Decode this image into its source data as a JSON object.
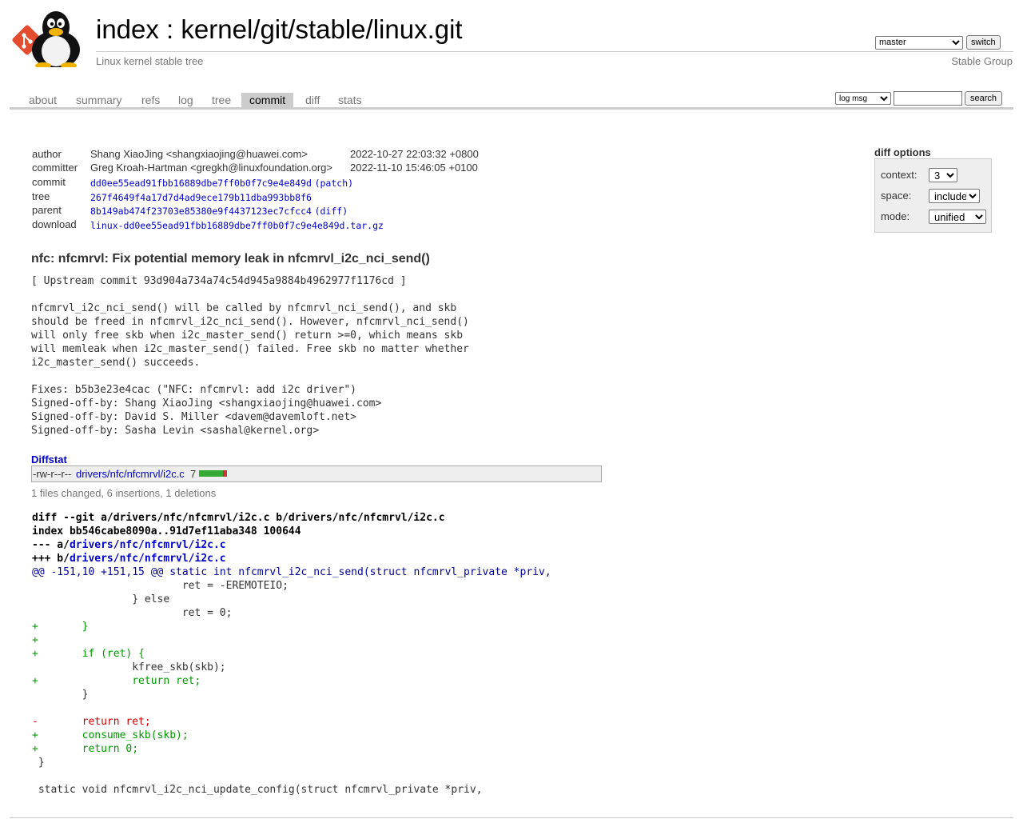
{
  "header": {
    "index_link": "index",
    "separator": " : ",
    "repo_path": "kernel/git/stable/linux.git",
    "description": "Linux kernel stable tree",
    "owner": "Stable Group",
    "branch_selected": "master",
    "switch_label": "switch"
  },
  "tabs": [
    "about",
    "summary",
    "refs",
    "log",
    "tree",
    "commit",
    "diff",
    "stats"
  ],
  "active_tab": "commit",
  "search": {
    "mode_selected": "log msg",
    "button_label": "search"
  },
  "diff_options": {
    "title": "diff options",
    "context_label": "context:",
    "context_value": "3",
    "space_label": "space:",
    "space_value": "include",
    "mode_label": "mode:",
    "mode_value": "unified"
  },
  "commit": {
    "author_label": "author",
    "author": "Shang XiaoJing <shangxiaojing@huawei.com>",
    "author_date": "2022-10-27 22:03:32 +0800",
    "committer_label": "committer",
    "committer": "Greg Kroah-Hartman <gregkh@linuxfoundation.org>",
    "committer_date": "2022-11-10 15:46:05 +0100",
    "commit_label": "commit",
    "commit_hash": "dd0ee55ead91fbb16889dbe7ff0b0f7c9e4e849d",
    "patch_link": "(patch)",
    "tree_label": "tree",
    "tree_hash": "267f4649f4a17d7d4ad9ece179b11dba993bb8f6",
    "parent_label": "parent",
    "parent_hash": "8b149ab474f23703e85380e9f4437123ec7cfcc4",
    "diff_link": "(diff)",
    "download_label": "download",
    "download_file": "linux-dd0ee55ead91fbb16889dbe7ff0b0f7c9e4e849d.tar.gz",
    "subject": "nfc: nfcmrvl: Fix potential memory leak in nfcmrvl_i2c_nci_send()",
    "message": "[ Upstream commit 93d904a734a74c54d945a9884b4962977f1176cd ]\n\nnfcmrvl_i2c_nci_send() will be called by nfcmrvl_nci_send(), and skb\nshould be freed in nfcmrvl_i2c_nci_send(). However, nfcmrvl_nci_send()\nwill only free skb when i2c_master_send() return >=0, which means skb\nwill memleak when i2c_master_send() failed. Free skb no matter whether\ni2c_master_send() succeeds.\n\nFixes: b5b3e23e4cac (\"NFC: nfcmrvl: add i2c driver\")\nSigned-off-by: Shang XiaoJing <shangxiaojing@huawei.com>\nSigned-off-by: David S. Miller <davem@davemloft.net>\nSigned-off-by: Sasha Levin <sashal@kernel.org>"
  },
  "diffstat": {
    "header": "Diffstat",
    "mode": "-rw-r--r--",
    "file": "drivers/nfc/nfcmrvl/i2c.c",
    "count": "7",
    "insertions": 6,
    "deletions": 1,
    "summary": "1 files changed, 6 insertions, 1 deletions",
    "colors": {
      "add": "#33aa33",
      "del": "#cc3333"
    }
  },
  "diff": {
    "git_line": "diff --git a/drivers/nfc/nfcmrvl/i2c.c b/drivers/nfc/nfcmrvl/i2c.c",
    "index_line": "index bb546cabe8090a..91d7ef11aba348 100644",
    "minus_prefix": "--- a/",
    "plus_prefix": "+++ b/",
    "file": "drivers/nfc/nfcmrvl/i2c.c",
    "hunk": "@@ -151,10 +151,15 @@",
    "hunk_context": " static int nfcmrvl_i2c_nci_send(struct nfcmrvl_private *priv,",
    "lines": [
      {
        "type": "ctx",
        "text": " \t\t\tret = -EREMOTEIO;"
      },
      {
        "type": "ctx",
        "text": " \t\t} else"
      },
      {
        "type": "ctx",
        "text": " \t\t\tret = 0;"
      },
      {
        "type": "add",
        "text": "+\t}"
      },
      {
        "type": "add",
        "text": "+"
      },
      {
        "type": "add",
        "text": "+\tif (ret) {"
      },
      {
        "type": "ctx",
        "text": " \t\tkfree_skb(skb);"
      },
      {
        "type": "add",
        "text": "+\t\treturn ret;"
      },
      {
        "type": "ctx",
        "text": " \t}"
      },
      {
        "type": "ctx",
        "text": " "
      },
      {
        "type": "del",
        "text": "-\treturn ret;"
      },
      {
        "type": "add",
        "text": "+\tconsume_skb(skb);"
      },
      {
        "type": "add",
        "text": "+\treturn 0;"
      },
      {
        "type": "ctx",
        "text": " }"
      },
      {
        "type": "ctx",
        "text": " "
      },
      {
        "type": "ctx",
        "text": " static void nfcmrvl_i2c_nci_update_config(struct nfcmrvl_private *priv,"
      }
    ]
  }
}
